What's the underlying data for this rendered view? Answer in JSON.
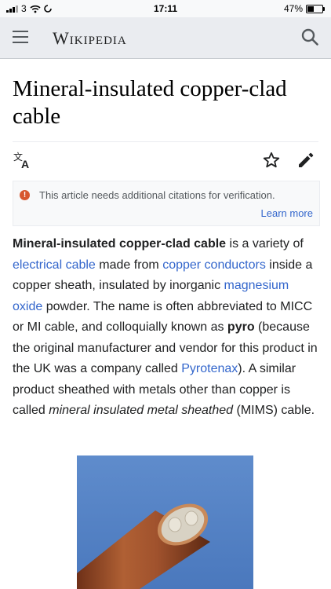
{
  "status_bar": {
    "carrier": "3",
    "time": "17:11",
    "battery_text": "47%",
    "battery_level": 0.47
  },
  "header": {
    "logo": "Wikipedia"
  },
  "article": {
    "title": "Mineral-insulated copper-clad cable",
    "notice": {
      "text": "This article needs additional citations for verification.",
      "link": "Learn more"
    },
    "paragraph": [
      {
        "t": "b",
        "text": "Mineral-insulated copper-clad cable"
      },
      {
        "t": "s",
        "text": " is a variety of "
      },
      {
        "t": "a",
        "text": "electrical cable"
      },
      {
        "t": "s",
        "text": " made from "
      },
      {
        "t": "a",
        "text": "copper conductors"
      },
      {
        "t": "s",
        "text": " inside a copper sheath, insulated by inorganic "
      },
      {
        "t": "a",
        "text": "magnesium oxide"
      },
      {
        "t": "s",
        "text": " powder. The name is often abbreviated to MICC or MI cable, and colloquially known as "
      },
      {
        "t": "b",
        "text": "pyro"
      },
      {
        "t": "s",
        "text": " (because the original manufacturer and vendor for this product in the UK was a company called "
      },
      {
        "t": "a",
        "text": "Pyrotenax"
      },
      {
        "t": "s",
        "text": "). A similar product sheathed with metals other than copper is called "
      },
      {
        "t": "i",
        "text": "mineral insulated metal sheathed"
      },
      {
        "t": "s",
        "text": " (MIMS) cable."
      }
    ]
  },
  "colors": {
    "link": "#3366cc",
    "warning": "#d7572f",
    "header_bg": "#eaecf0",
    "image_bg": "#5b86c6",
    "cable_copper": "#a0522d"
  },
  "icons": {
    "menu": "hamburger-icon",
    "search": "search-icon",
    "language": "language-icon",
    "watch": "star-icon",
    "edit": "pencil-icon",
    "warning": "warning-icon"
  }
}
